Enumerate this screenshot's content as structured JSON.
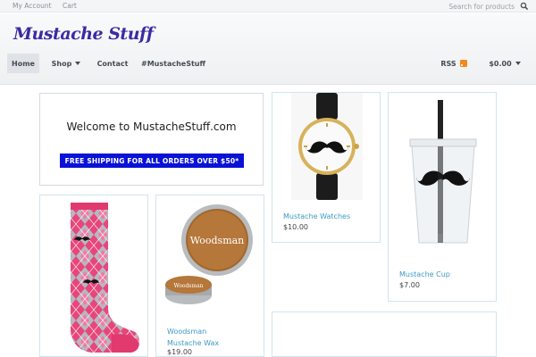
{
  "topbar": {
    "my_account": "My Account",
    "cart": "Cart",
    "search_placeholder": "Search for products"
  },
  "header": {
    "logo": "Mustache Stuff"
  },
  "nav": {
    "home": "Home",
    "shop": "Shop",
    "contact": "Contact",
    "hashtag": "#MustacheStuff",
    "rss": "RSS",
    "cart_total": "$0.00"
  },
  "welcome": {
    "title": "Welcome to MustacheStuff.com",
    "promo": "FREE SHIPPING FOR ALL ORDERS OVER $50*"
  },
  "products": [
    {
      "name": "Mustache Watches",
      "price": "$10.00"
    },
    {
      "name": "Mustache Cup",
      "price": "$7.00"
    },
    {
      "name_line1": "Woodsman",
      "name_line2": "Mustache Wax",
      "price": "$19.00"
    }
  ],
  "colors": {
    "brand": "#3b2aa5",
    "promo_bg": "#0a12d6",
    "link": "#3d9ac4",
    "rss": "#f28a1e"
  },
  "icons": [
    "search-icon",
    "chevron-down-icon",
    "rss-icon"
  ]
}
